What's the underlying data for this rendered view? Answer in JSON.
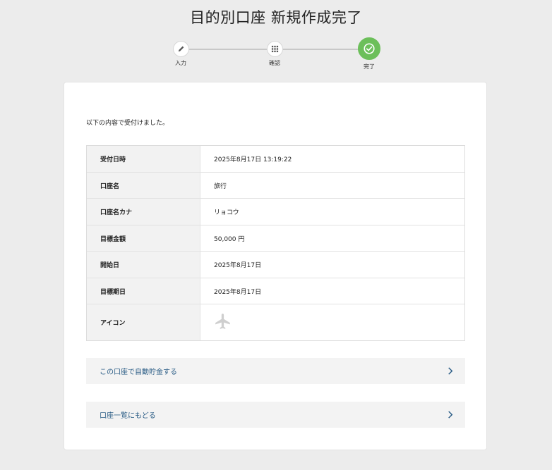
{
  "title": "目的別口座 新規作成完了",
  "steps": [
    {
      "label": "入力",
      "icon": "pencil-icon"
    },
    {
      "label": "確認",
      "icon": "grid-icon"
    },
    {
      "label": "完了",
      "icon": "check-icon"
    }
  ],
  "intro": "以下の内容で受付けました。",
  "rows": [
    {
      "key": "受付日時",
      "value": "2025年8月17日 13:19:22"
    },
    {
      "key": "口座名",
      "value": "旅行"
    },
    {
      "key": "口座名カナ",
      "value": "リョコウ"
    },
    {
      "key": "目標金額",
      "value": "50,000 円"
    },
    {
      "key": "開始日",
      "value": "2025年8月17日"
    },
    {
      "key": "目標期日",
      "value": "2025年8月17日"
    },
    {
      "key": "アイコン",
      "icon": "airplane-icon"
    }
  ],
  "actions": {
    "auto_save": "この口座で自動貯金する",
    "account_list": "口座一覧にもどる"
  },
  "colors": {
    "active_step": "#6cbf5a",
    "link": "#2b5d86"
  }
}
